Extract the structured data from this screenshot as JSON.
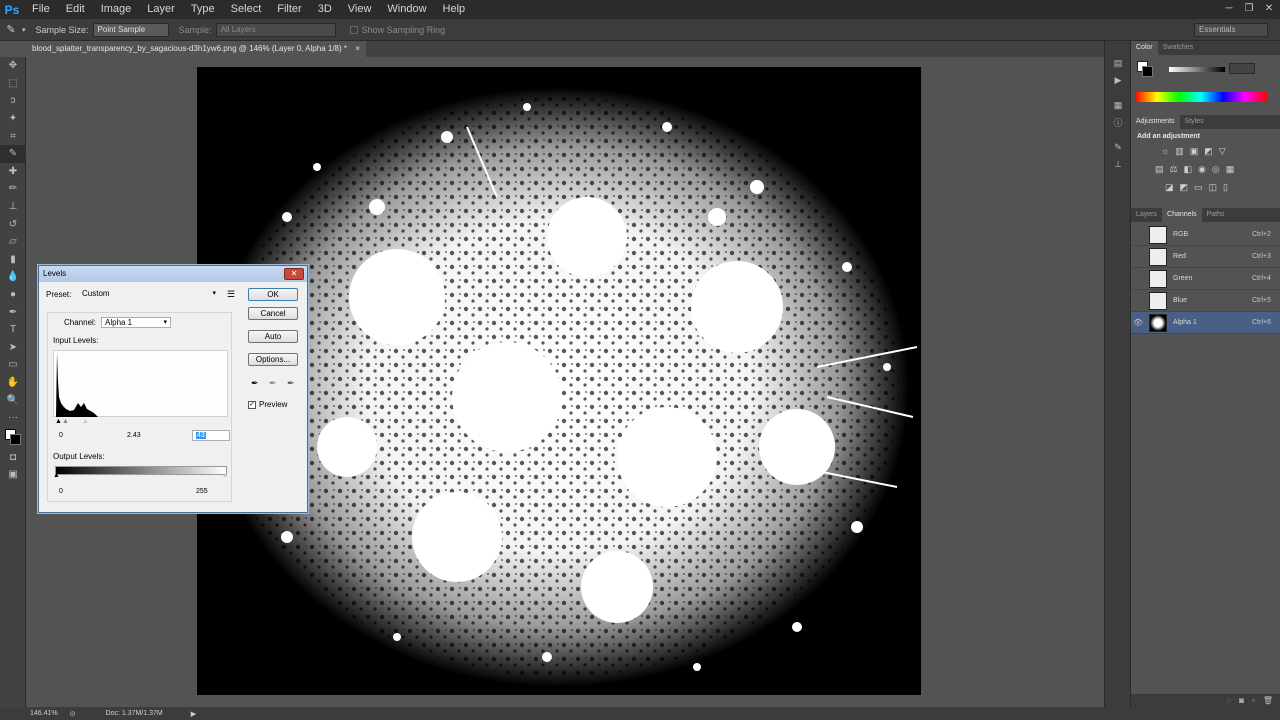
{
  "app": {
    "logo": "Ps"
  },
  "menu": [
    "File",
    "Edit",
    "Image",
    "Layer",
    "Type",
    "Select",
    "Filter",
    "3D",
    "View",
    "Window",
    "Help"
  ],
  "options_bar": {
    "sample_size_label": "Sample Size:",
    "sample_size_value": "Point Sample",
    "sample_label": "Sample:",
    "sample_value": "All Layers",
    "show_ring_label": "Show Sampling Ring",
    "workspace": "Essentials"
  },
  "document_tab": "blood_splatter_transparency_by_sagacious-d3h1yw6.png @ 146% (Layer 0, Alpha 1/8) *",
  "status": {
    "zoom": "146.41%",
    "doc": "Doc: 1.37M/1.37M"
  },
  "panels": {
    "color_tabs": [
      "Color",
      "Swatches"
    ],
    "adjust_tabs": [
      "Adjustments",
      "Styles"
    ],
    "add_adjustment": "Add an adjustment",
    "layer_tabs": [
      "Layers",
      "Channels",
      "Paths"
    ],
    "channels": [
      {
        "name": "RGB",
        "shortcut": "Ctrl+2"
      },
      {
        "name": "Red",
        "shortcut": "Ctrl+3"
      },
      {
        "name": "Green",
        "shortcut": "Ctrl+4"
      },
      {
        "name": "Blue",
        "shortcut": "Ctrl+5"
      },
      {
        "name": "Alpha 1",
        "shortcut": "Ctrl+6"
      }
    ]
  },
  "levels_dialog": {
    "title": "Levels",
    "preset_label": "Preset:",
    "preset_value": "Custom",
    "channel_label": "Channel:",
    "channel_value": "Alpha 1",
    "input_levels_label": "Input Levels:",
    "input_black": "0",
    "input_gamma": "2.43",
    "input_white": "43",
    "output_levels_label": "Output Levels:",
    "output_black": "0",
    "output_white": "255",
    "ok": "OK",
    "cancel": "Cancel",
    "auto": "Auto",
    "options": "Options...",
    "preview_label": "Preview",
    "preview_checked": true
  }
}
